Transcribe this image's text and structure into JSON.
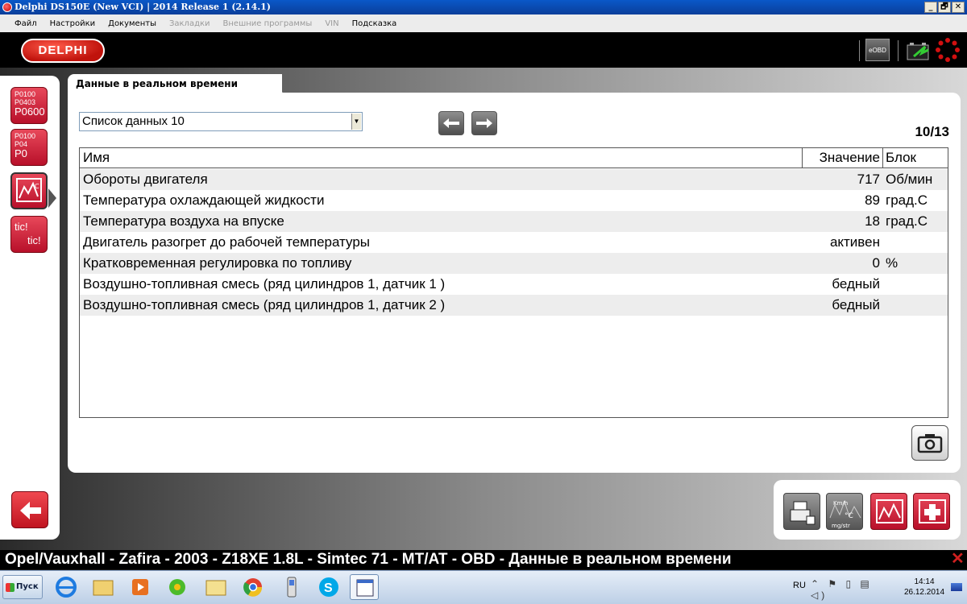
{
  "window": {
    "title": "Delphi DS150E (New VCI) | 2014 Release 1 (2.14.1)",
    "buttons": [
      "_",
      "🗗",
      "✕"
    ]
  },
  "menu": {
    "items": [
      {
        "label": "Файл",
        "enabled": true
      },
      {
        "label": "Настройки",
        "enabled": true
      },
      {
        "label": "Документы",
        "enabled": true
      },
      {
        "label": "Закладки",
        "enabled": false
      },
      {
        "label": "Внешние программы",
        "enabled": false
      },
      {
        "label": "VIN",
        "enabled": false
      },
      {
        "label": "Подсказка",
        "enabled": true
      }
    ]
  },
  "header": {
    "logo": "DELPHI",
    "eobd_label": "eOBD",
    "icons": [
      "eobd-icon",
      "battery-icon",
      "gear-icon"
    ]
  },
  "sidebar": {
    "buttons": [
      {
        "name": "fault-codes",
        "codes": [
          "P0100",
          "P0403",
          "P0600"
        ]
      },
      {
        "name": "clear-codes",
        "codes": [
          "P0100",
          "P04",
          "P0"
        ]
      },
      {
        "name": "live-data",
        "icon": "gauge-chart-icon",
        "active": true
      },
      {
        "name": "actuators",
        "text": [
          "tic!",
          "tic!"
        ]
      }
    ],
    "back_icon": "back-arrow-icon"
  },
  "panel": {
    "tab_label": "Данные в реальном времени",
    "list_select": "Список данных 10",
    "counter": "10/13",
    "columns": {
      "name": "Имя",
      "value": "Значение",
      "unit": "Блок"
    },
    "rows": [
      {
        "name": "Обороты двигателя",
        "value": "717",
        "unit": "Об/мин"
      },
      {
        "name": "Температура охлаждающей жидкости",
        "value": "89",
        "unit": "град.С"
      },
      {
        "name": "Температура воздуха на впуске",
        "value": "18",
        "unit": "град.С"
      },
      {
        "name": "Двигатель разогрет до рабочей температуры",
        "value": "активен",
        "unit": ""
      },
      {
        "name": "Кратковременная регулировка по топливу",
        "value": "0",
        "unit": "%"
      },
      {
        "name": "Воздушно-топливная смесь (ряд цилиндров 1, датчик 1 )",
        "value": "бедный",
        "unit": ""
      },
      {
        "name": "Воздушно-топливная смесь (ряд цилиндров 1, датчик 2 )",
        "value": "бедный",
        "unit": ""
      }
    ]
  },
  "tools": {
    "labels": [
      "Km/h",
      "°C",
      "mg/str"
    ]
  },
  "status": {
    "text": "Opel/Vauxhall - Zafira - 2003 - Z18XE 1.8L - Simtec 71 - MT/AT - OBD - Данные в реальном времени"
  },
  "taskbar": {
    "start_label": "Пуск",
    "apps": [
      "ie-icon",
      "folder-icon",
      "media-player-icon",
      "icq-icon",
      "folder-icon",
      "chrome-icon",
      "phone-icon",
      "skype-icon",
      "window-icon"
    ],
    "lang": "RU",
    "time": "14:14",
    "date": "26.12.2014"
  },
  "colors": {
    "accent_red": "#c8102e",
    "title_blue": "#0a4ab0"
  }
}
